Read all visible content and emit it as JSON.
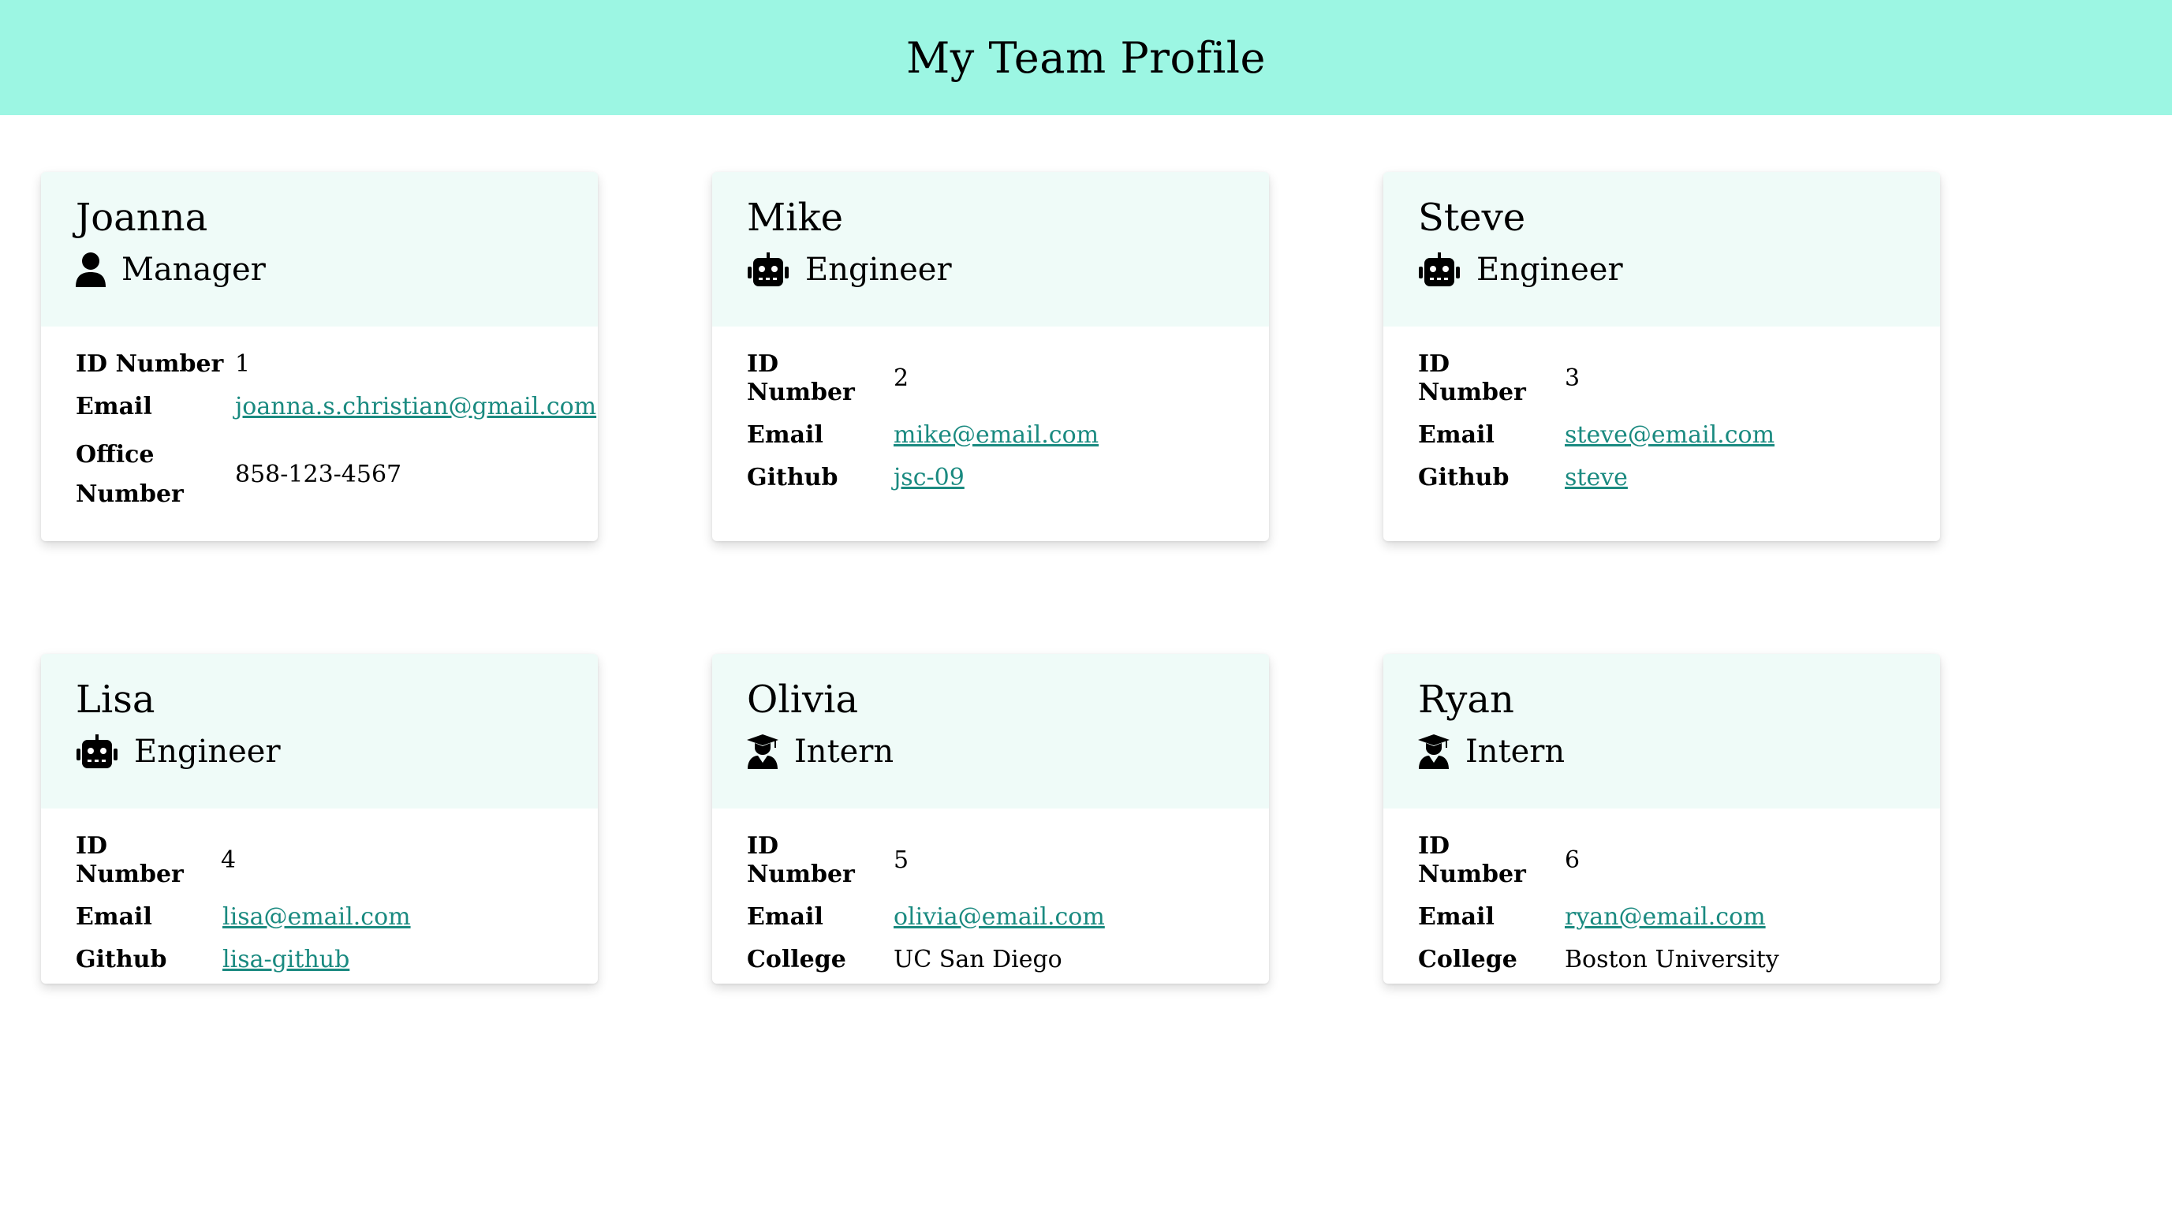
{
  "header": {
    "title": "My Team Profile"
  },
  "labels": {
    "id": "ID Number",
    "email": "Email",
    "github": "Github",
    "office_line1": "Office",
    "office_line2": "Number",
    "college": "College"
  },
  "colors": {
    "header_bg": "#9cf6e3",
    "card_head_bg": "#effbf8",
    "link": "#1a8a80"
  },
  "cards": [
    {
      "name": "Joanna",
      "role": "Manager",
      "icon": "user-icon",
      "id": "1",
      "email": "joanna.s.christian@gmail.com",
      "office": "858-123-4567"
    },
    {
      "name": "Mike",
      "role": "Engineer",
      "icon": "robot-icon",
      "id": "2",
      "email": "mike@email.com",
      "github": "jsc-09"
    },
    {
      "name": "Steve",
      "role": "Engineer",
      "icon": "robot-icon",
      "id": "3",
      "email": "steve@email.com",
      "github": "steve"
    },
    {
      "name": "Lisa",
      "role": "Engineer",
      "icon": "robot-icon",
      "id": "4",
      "email": "lisa@email.com",
      "github": "lisa-github"
    },
    {
      "name": "Olivia",
      "role": "Intern",
      "icon": "graduate-icon",
      "id": "5",
      "email": "olivia@email.com",
      "college": "UC San Diego"
    },
    {
      "name": "Ryan",
      "role": "Intern",
      "icon": "graduate-icon",
      "id": "6",
      "email": "ryan@email.com",
      "college": "Boston University"
    }
  ]
}
